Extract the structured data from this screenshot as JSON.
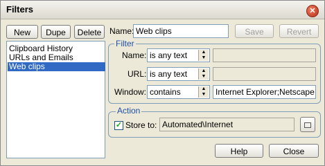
{
  "window": {
    "title": "Filters"
  },
  "toolbar": {
    "new_label": "New",
    "dupe_label": "Dupe",
    "delete_label": "Delete"
  },
  "filters_list": {
    "items": [
      {
        "label": "Clipboard History"
      },
      {
        "label": "URLs and Emails"
      },
      {
        "label": "Web clips"
      }
    ],
    "selected": "Web clips"
  },
  "name": {
    "label": "Name:",
    "value": "Web clips"
  },
  "actions": {
    "save_label": "Save",
    "revert_label": "Revert"
  },
  "filter": {
    "title": "Filter",
    "rows": [
      {
        "label": "Name:",
        "operator": "is any text",
        "value": ""
      },
      {
        "label": "URL:",
        "operator": "is any text",
        "value": ""
      },
      {
        "label": "Window:",
        "operator": "contains",
        "value": "Internet Explorer;Netscape Na"
      }
    ]
  },
  "action": {
    "title": "Action",
    "store_label": "Store to:",
    "store_checked": true,
    "store_value": "Automated\\Internet"
  },
  "footer": {
    "help_label": "Help",
    "close_label": "Close"
  }
}
